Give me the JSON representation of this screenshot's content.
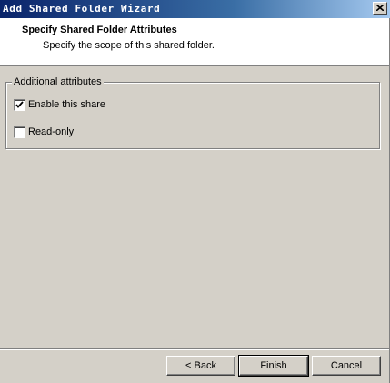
{
  "window": {
    "title": "Add Shared Folder Wizard"
  },
  "header": {
    "title": "Specify Shared Folder Attributes",
    "subtitle": "Specify the scope of this shared folder."
  },
  "group": {
    "legend": "Additional attributes",
    "options": [
      {
        "label": "Enable this share",
        "checked": true
      },
      {
        "label": "Read-only",
        "checked": false
      }
    ]
  },
  "buttons": {
    "back": "< Back",
    "finish": "Finish",
    "cancel": "Cancel"
  },
  "colors": {
    "titlebar_start": "#0a246a",
    "titlebar_end": "#a6caf0",
    "face": "#d4d0c8"
  }
}
